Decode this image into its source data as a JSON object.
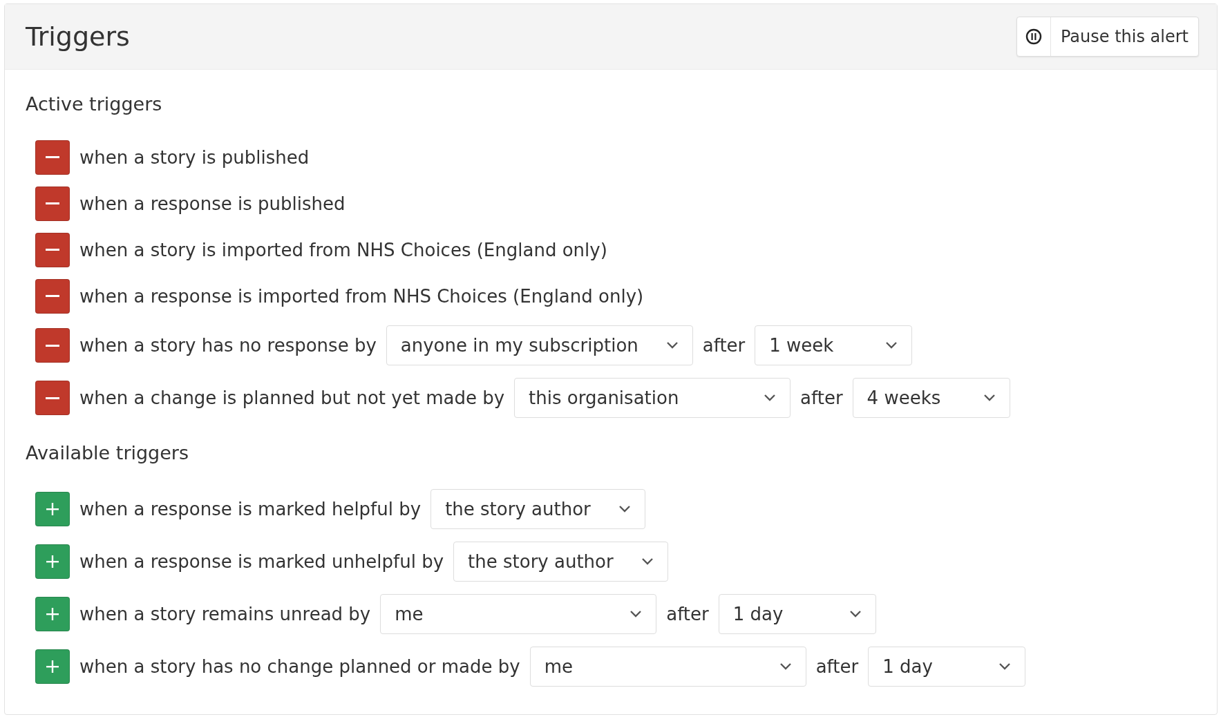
{
  "panel": {
    "title": "Triggers",
    "pause_button": "Pause this alert"
  },
  "sections": [
    {
      "title": "Active triggers",
      "kind": "active",
      "triggers": [
        {
          "text": "when a story is published"
        },
        {
          "text": "when a response is published"
        },
        {
          "text": "when a story is imported from NHS Choices (England only)"
        },
        {
          "text": "when a response is imported from NHS Choices (England only)"
        },
        {
          "text": "when a story has no response by",
          "by": "anyone in my subscription",
          "after_label": "after",
          "after": "1 week"
        },
        {
          "text": "when a change is planned but not yet made by",
          "by": "this organisation",
          "after_label": "after",
          "after": "4 weeks"
        }
      ]
    },
    {
      "title": "Available triggers",
      "kind": "available",
      "triggers": [
        {
          "text": "when a response is marked helpful by",
          "by": "the story author"
        },
        {
          "text": "when a response is marked unhelpful by",
          "by": "the story author"
        },
        {
          "text": "when a story remains unread by",
          "by": "me",
          "after_label": "after",
          "after": "1 day"
        },
        {
          "text": "when a story has no change planned or made by",
          "by": "me",
          "after_label": "after",
          "after": "1 day"
        }
      ]
    }
  ]
}
